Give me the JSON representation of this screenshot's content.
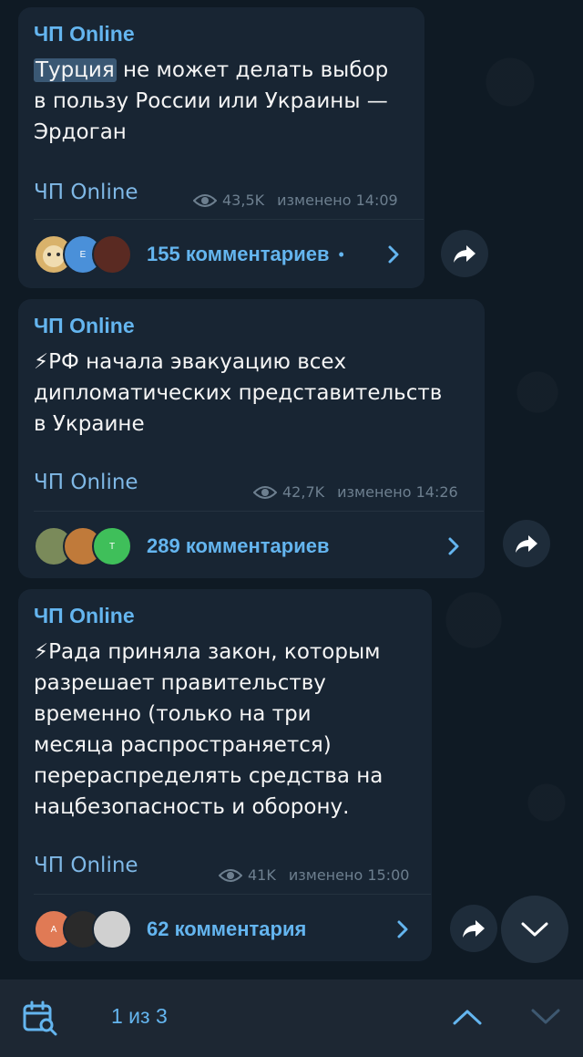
{
  "messages": [
    {
      "channel": "ЧП Online",
      "text_highlight": "Турция",
      "text_rest": " не может делать выбор\nв пользу России или Украины —\nЭрдоган",
      "signature": "ЧП Online",
      "views": "43,5K",
      "edited": "изменено 14:09",
      "comments": "155 комментариев",
      "unread_dot": "•"
    },
    {
      "channel": "ЧП Online",
      "text": "⚡РФ начала эвакуацию всех\nдипломатических представительств\nв Украине",
      "signature": "ЧП Online",
      "views": "42,7K",
      "edited": "изменено 14:26",
      "comments": "289 комментариев"
    },
    {
      "channel": "ЧП Online",
      "text": "⚡Рада приняла закон, которым\nразрешает правительству\nвременно (только на три\nмесяца распространяется)\nперераспределять средства на\nнацбезопасность и оборону.",
      "signature": "ЧП Online",
      "views": "41K",
      "edited": "изменено 15:00",
      "comments": "62 комментария",
      "avatar_letter": "A"
    }
  ],
  "avatar_letters": {
    "m1": "E",
    "m2": "T"
  },
  "search_nav": {
    "counter": "1 из 3"
  },
  "colors": {
    "accent": "#64b5ef",
    "bubble": "#182533",
    "background": "#0f1a24"
  },
  "icons": [
    "eye-icon",
    "chevron-right-icon",
    "share-icon",
    "calendar-search-icon",
    "chevron-up-icon",
    "chevron-down-icon"
  ]
}
